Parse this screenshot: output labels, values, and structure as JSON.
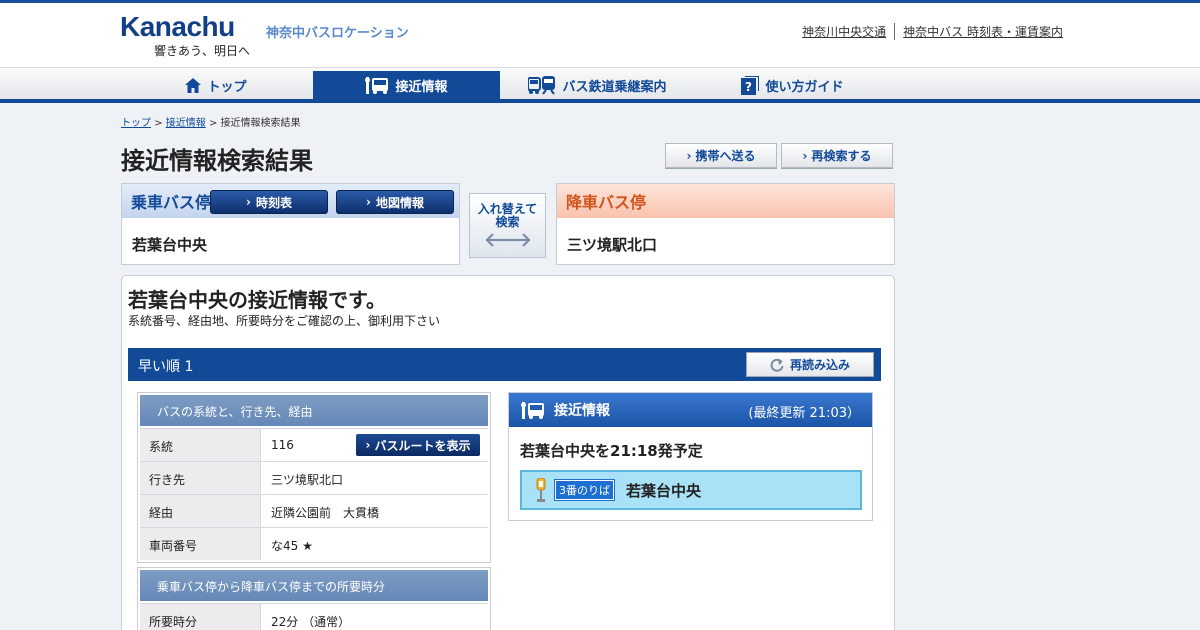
{
  "header": {
    "logo_text": "Kanachu",
    "tagline": "響きあう、明日へ",
    "site_title": "神奈中バスロケーション",
    "links": [
      "神奈川中央交通",
      "神奈中バス 時刻表・運賃案内"
    ]
  },
  "nav": {
    "items": [
      {
        "label": "トップ",
        "icon": "home-icon"
      },
      {
        "label": "接近情報",
        "icon": "bus-stop-icon"
      },
      {
        "label": "バス鉄道乗継案内",
        "icon": "bus-train-icon"
      },
      {
        "label": "使い方ガイド",
        "icon": "guide-icon"
      }
    ],
    "active_index": 1
  },
  "breadcrumb": {
    "items": [
      "トップ",
      "接近情報",
      "接近情報検索結果"
    ],
    "separator": ">"
  },
  "page": {
    "title": "接近情報検索結果",
    "send_mobile_label": "携帯へ送る",
    "research_label": "再検索する"
  },
  "boarding": {
    "heading": "乗車バス停",
    "timetable_label": "時刻表",
    "map_label": "地図情報",
    "stop_name": "若葉台中央"
  },
  "swap": {
    "label_line1": "入れ替えて",
    "label_line2": "検索"
  },
  "alighting": {
    "heading": "降車バス停",
    "stop_name": "三ツ境駅北口"
  },
  "result": {
    "heading": "若葉台中央の接近情報です。",
    "subtext": "系統番号、経由地、所要時分をご確認の上、御利用下さい",
    "order_label": "早い順 1",
    "reload_label": "再読み込み",
    "route_table": {
      "heading": "バスの系統と、行き先、経由",
      "rows": [
        {
          "label": "系統",
          "value": "116"
        },
        {
          "label": "行き先",
          "value": "三ツ境駅北口"
        },
        {
          "label": "経由",
          "value": "近隣公園前　大貫橋"
        },
        {
          "label": "車両番号",
          "value": "な45 ★"
        }
      ],
      "route_button_label": "バスルートを表示"
    },
    "time_table": {
      "heading": "乗車バス停から降車バス停までの所要時分",
      "rows": [
        {
          "label": "所要時分",
          "value": "22分 （通常）"
        }
      ]
    },
    "approach": {
      "heading": "接近情報",
      "updated": "(最終更新 21:03）",
      "departure": "若葉台中央を21:18発予定",
      "platform_tag": "3番のりば",
      "position_stop": "若葉台中央"
    }
  },
  "colors": {
    "brand_navy": "#134a98",
    "board_head": "#c3d4ee",
    "alight_head": "#f9c3ad",
    "position_bg": "#a9e2f6"
  }
}
